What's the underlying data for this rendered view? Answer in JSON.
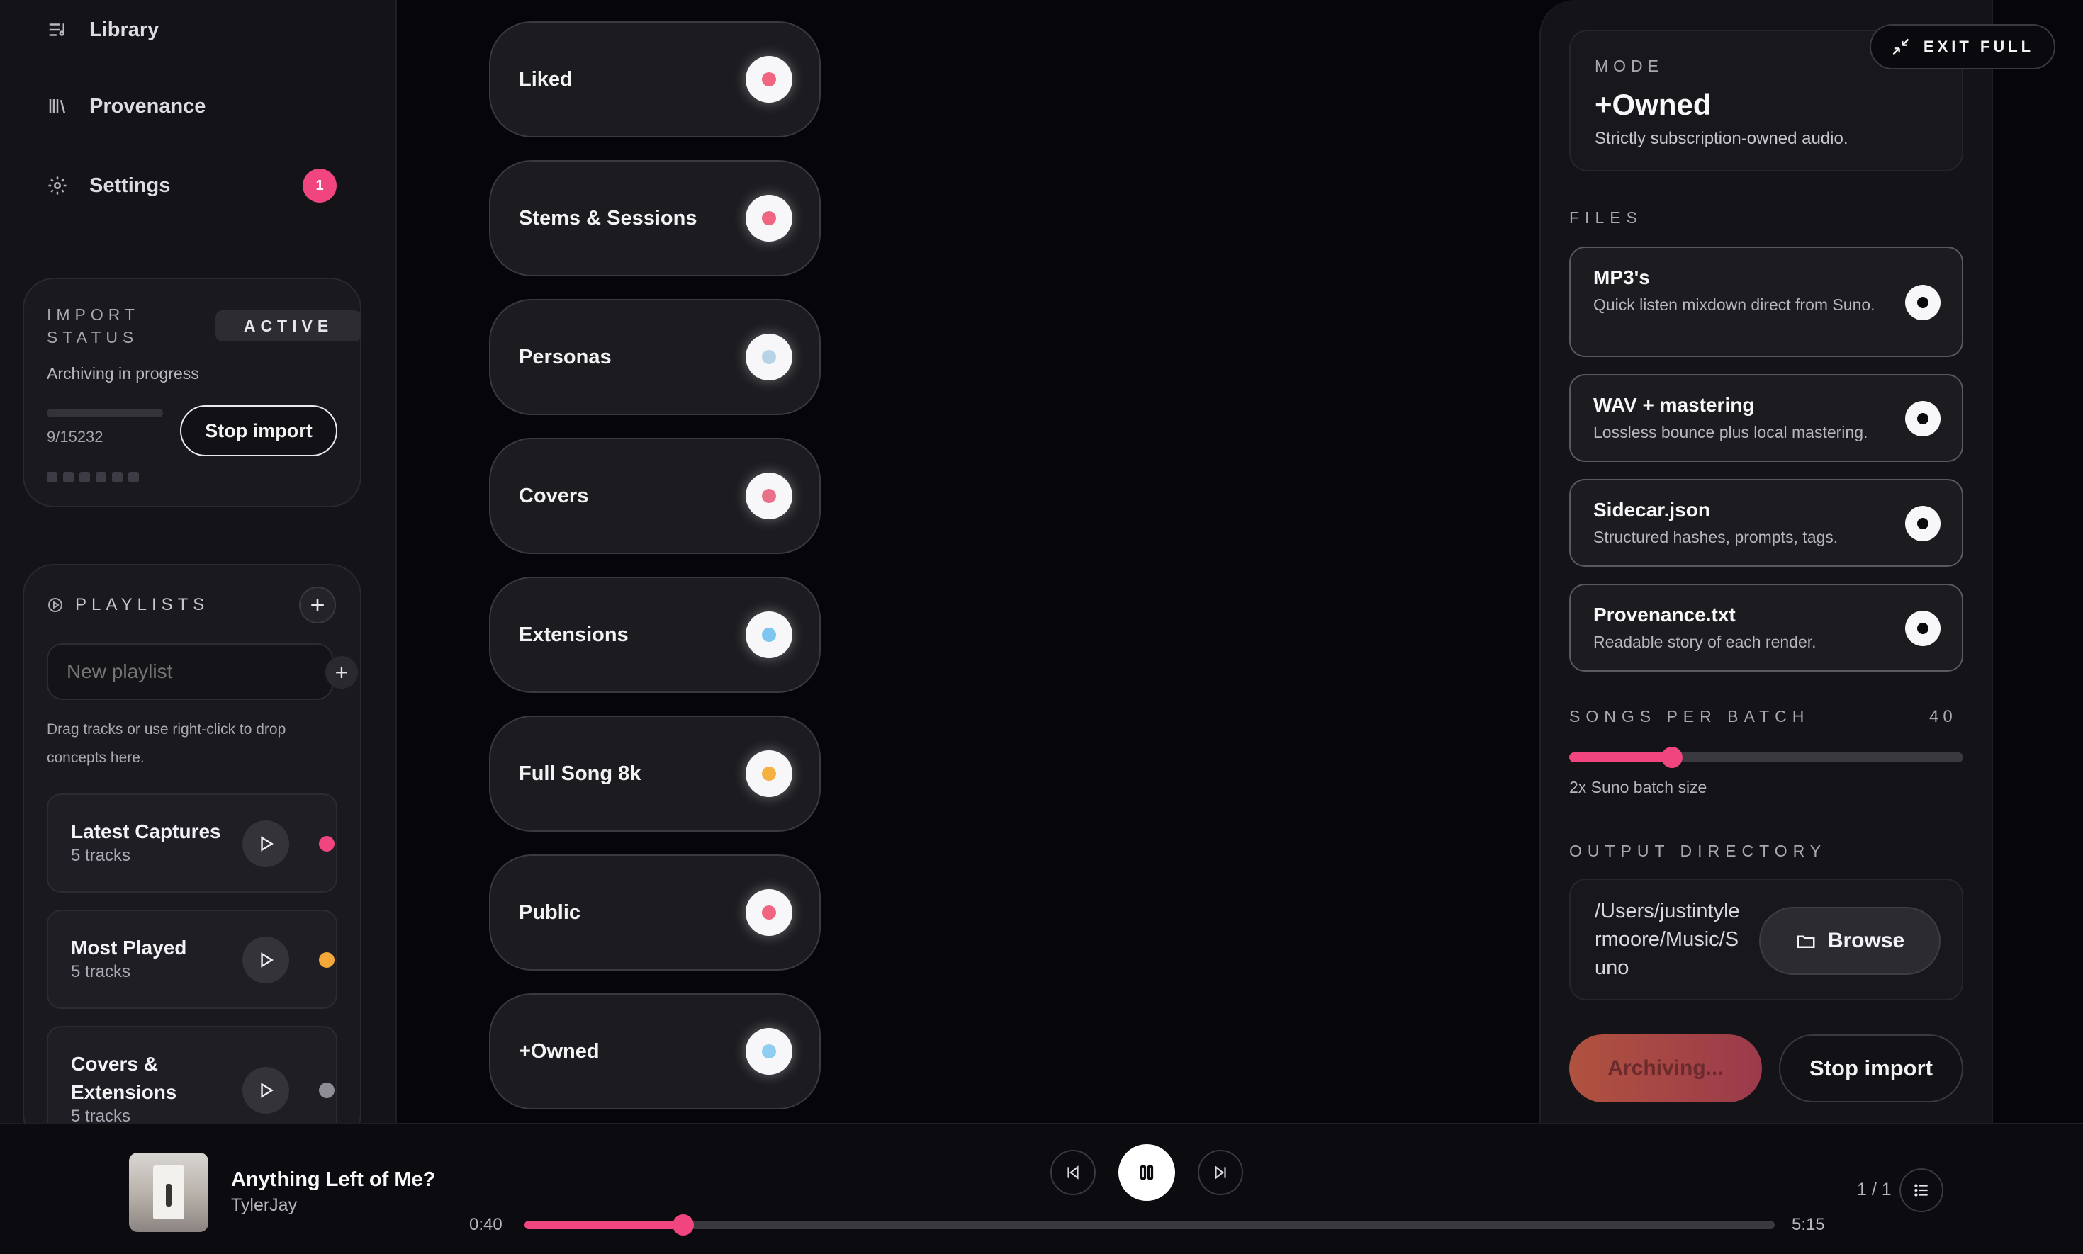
{
  "sidebar": {
    "nav": [
      {
        "label": "Library",
        "icon": "library-icon"
      },
      {
        "label": "Provenance",
        "icon": "provenance-icon"
      },
      {
        "label": "Settings",
        "icon": "gear-icon",
        "badge": "1"
      }
    ],
    "import_status": {
      "title": "IMPORT STATUS",
      "state": "ACTIVE",
      "subtitle": "Archiving in progress",
      "count": "9/15232",
      "progress": 0.0006,
      "stop_label": "Stop import"
    },
    "playlists": {
      "title": "PLAYLISTS",
      "input_placeholder": "New playlist",
      "hint": "Drag tracks or use right-click to drop concepts here.",
      "items": [
        {
          "name": "Latest Captures",
          "count": "5 tracks",
          "color": "#f0457f"
        },
        {
          "name": "Most Played",
          "count": "5 tracks",
          "color": "#f5a83a"
        },
        {
          "name": "Covers & Extensions",
          "count": "5 tracks",
          "color": "#8e8d96"
        }
      ]
    }
  },
  "filters": [
    {
      "label": "Liked",
      "dot": "#f0657f"
    },
    {
      "label": "Stems & Sessions",
      "dot": "#f0657f"
    },
    {
      "label": "Personas",
      "dot": "#b7d3e8"
    },
    {
      "label": "Covers",
      "dot": "#e9708a"
    },
    {
      "label": "Extensions",
      "dot": "#7cc6f0"
    },
    {
      "label": "Full Song 8k",
      "dot": "#f5b042"
    },
    {
      "label": "Public",
      "dot": "#f0657f"
    },
    {
      "label": "+Owned",
      "dot": "#8fcdf2"
    }
  ],
  "right_panel": {
    "exit_label": "EXIT FULL",
    "mode": {
      "caption": "MODE",
      "title": "+Owned",
      "subtitle": "Strictly subscription-owned audio."
    },
    "files": {
      "caption": "FILES",
      "items": [
        {
          "title": "MP3's",
          "desc": "Quick listen mixdown direct from Suno.",
          "selected": true
        },
        {
          "title": "WAV + mastering",
          "desc": "Lossless bounce plus local mastering.",
          "selected": true
        },
        {
          "title": "Sidecar.json",
          "desc": "Structured hashes, prompts, tags.",
          "selected": true
        },
        {
          "title": "Provenance.txt",
          "desc": "Readable story of each render.",
          "selected": true
        }
      ]
    },
    "batch": {
      "caption": "SONGS PER BATCH",
      "value": "40",
      "fraction": 0.26,
      "subtitle": "2x Suno batch size"
    },
    "output": {
      "caption": "OUTPUT DIRECTORY",
      "path": "/Users/justintylermoore/Music/Suno",
      "browse_label": "Browse"
    },
    "archiving_label": "Archiving...",
    "stop_label": "Stop import"
  },
  "player": {
    "title": "Anything Left of Me?",
    "artist": "TylerJay",
    "current": "0:40",
    "total": "5:15",
    "progress": 0.127,
    "queue": "1 / 1"
  }
}
